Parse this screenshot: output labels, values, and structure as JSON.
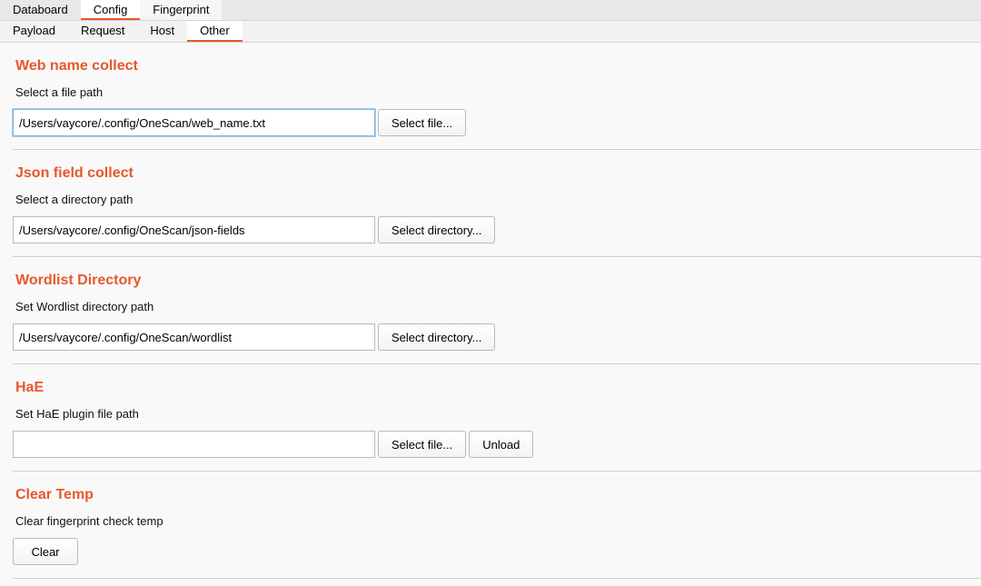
{
  "tabs": {
    "top": [
      "Databoard",
      "Config",
      "Fingerprint"
    ],
    "active_top": "Config",
    "sub": [
      "Payload",
      "Request",
      "Host",
      "Other"
    ],
    "active_sub": "Other"
  },
  "sections": {
    "web_name": {
      "title": "Web name collect",
      "desc": "Select a file path",
      "path": "/Users/vaycore/.config/OneScan/web_name.txt",
      "button": "Select file..."
    },
    "json_field": {
      "title": "Json field collect",
      "desc": "Select a directory path",
      "path": "/Users/vaycore/.config/OneScan/json-fields",
      "button": "Select directory..."
    },
    "wordlist": {
      "title": "Wordlist Directory",
      "desc": "Set Wordlist directory path",
      "path": "/Users/vaycore/.config/OneScan/wordlist",
      "button": "Select directory..."
    },
    "hae": {
      "title": "HaE",
      "desc": "Set HaE plugin file path",
      "path": "",
      "button": "Select file...",
      "unload_button": "Unload"
    },
    "clear_temp": {
      "title": "Clear Temp",
      "desc": "Clear fingerprint check temp",
      "button": "Clear"
    }
  },
  "colors": {
    "accent": "#e8582c",
    "background": "#f9f9f9"
  }
}
